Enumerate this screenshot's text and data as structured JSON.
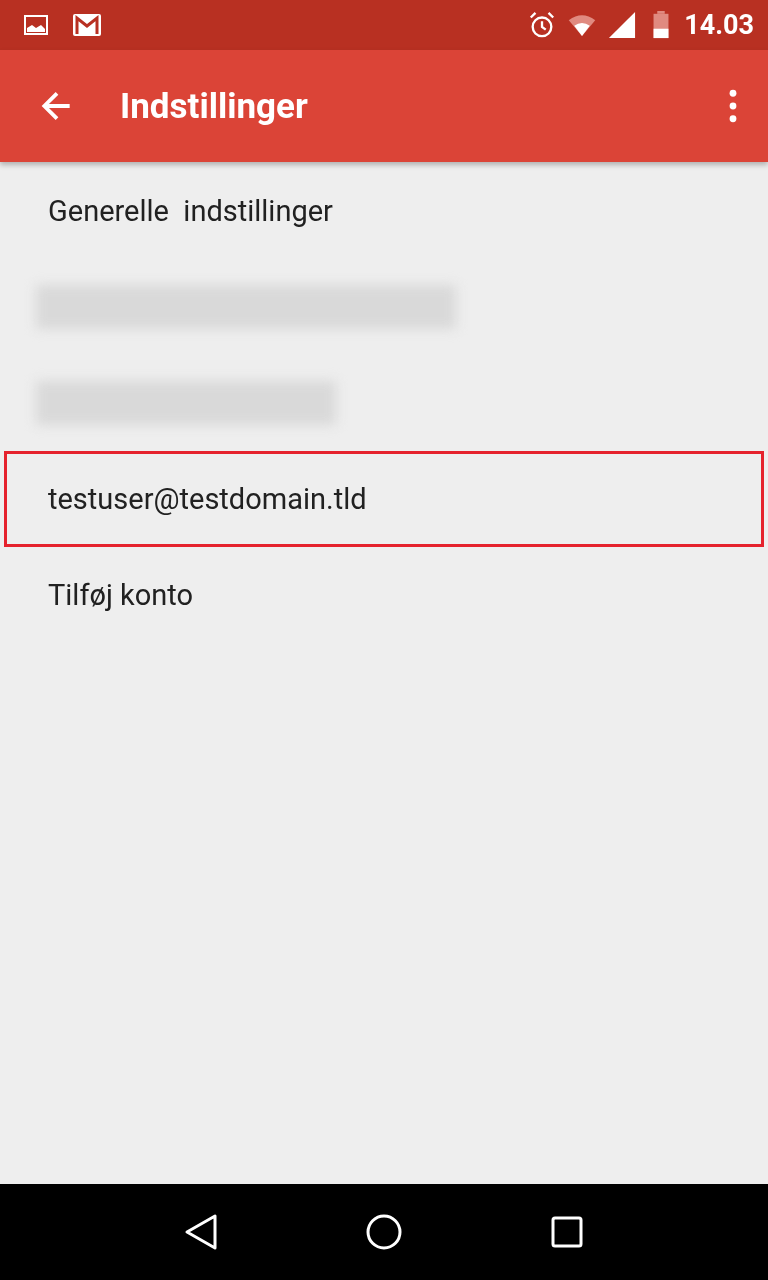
{
  "status_bar": {
    "time": "14.03"
  },
  "app_bar": {
    "title": "Indstillinger"
  },
  "items": [
    {
      "kind": "text",
      "label": "Generelle  indstillinger",
      "highlighted": false
    },
    {
      "kind": "redacted",
      "highlighted": false
    },
    {
      "kind": "redacted",
      "highlighted": false
    },
    {
      "kind": "text",
      "label": "testuser@testdomain.tld",
      "highlighted": true
    },
    {
      "kind": "text",
      "label": "Tilføj konto",
      "highlighted": false
    }
  ]
}
